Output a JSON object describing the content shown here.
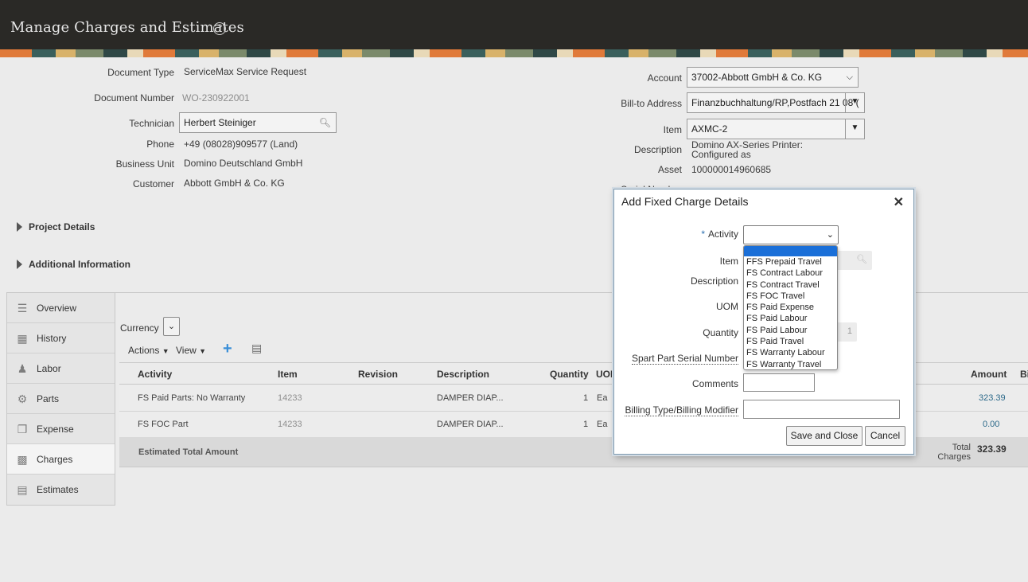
{
  "header": {
    "title": "Manage Charges and Estimates",
    "help_icon": "question-circle-icon"
  },
  "document": {
    "document_type_label": "Document Type",
    "document_type": "ServiceMax Service Request",
    "document_number_label": "Document Number",
    "document_number": "WO-230922001",
    "technician_label": "Technician",
    "technician": "Herbert Steiniger",
    "phone_label": "Phone",
    "phone": "+49 (08028)909577 (Land)",
    "business_unit_label": "Business Unit",
    "business_unit": "Domino Deutschland GmbH",
    "customer_label": "Customer",
    "customer": "Abbott GmbH & Co. KG"
  },
  "account_info": {
    "account_label": "Account",
    "account": "37002-Abbott GmbH & Co. KG",
    "bill_to_label": "Bill-to Address",
    "bill_to": "Finanzbuchhaltung/RP,Postfach 21 08 (",
    "item_label": "Item",
    "item": "AXMC-2",
    "description_label": "Description",
    "description_line1": "Domino AX-Series Printer:",
    "description_line2": "Configured as",
    "asset_label": "Asset",
    "asset": "100000014960685",
    "serial_label": "Serial Number"
  },
  "sections": {
    "project_details": "Project Details",
    "additional_information": "Additional Information"
  },
  "sidetabs": [
    {
      "label": "Overview",
      "icon": "overview-icon"
    },
    {
      "label": "History",
      "icon": "history-icon"
    },
    {
      "label": "Labor",
      "icon": "labor-icon"
    },
    {
      "label": "Parts",
      "icon": "parts-icon"
    },
    {
      "label": "Expense",
      "icon": "expense-icon"
    },
    {
      "label": "Charges",
      "icon": "charges-icon"
    },
    {
      "label": "Estimates",
      "icon": "estimates-icon"
    }
  ],
  "toolbar": {
    "currency_label": "Currency",
    "actions_label": "Actions",
    "view_label": "View"
  },
  "table": {
    "columns": {
      "activity": "Activity",
      "item": "Item",
      "revision": "Revision",
      "description": "Description",
      "quantity": "Quantity",
      "uom": "UOM",
      "amount": "Amount",
      "bi": "Bi"
    },
    "rows": [
      {
        "activity": "FS Paid Parts: No Warranty",
        "item": "14233",
        "description": "DAMPER DIAP...",
        "quantity": "1",
        "uom": "Ea",
        "amount": "323.39"
      },
      {
        "activity": "FS FOC Part",
        "item": "14233",
        "description": "DAMPER DIAP...",
        "quantity": "1",
        "uom": "Ea",
        "amount": "0.00"
      }
    ],
    "footer": {
      "estimated_total_label": "Estimated Total Amount",
      "total_charges_label_1": "Total",
      "total_charges_label_2": "Charges",
      "total_charges": "323.39"
    }
  },
  "modal": {
    "title": "Add Fixed Charge Details",
    "activity_label": "Activity",
    "item_label": "Item",
    "description_label": "Description",
    "uom_label": "UOM",
    "quantity_label": "Quantity",
    "quantity_value": "1",
    "spare_serial_label": "Spart Part Serial Number",
    "comments_label": "Comments",
    "billing_type_label": "Billing Type/Billing Modifier",
    "save_close_button": "Save and Close",
    "cancel_button": "Cancel"
  },
  "activity_options": [
    "",
    "FFS Prepaid Travel",
    "FS Contract Labour",
    "FS Contract Travel",
    "FS FOC Travel",
    "FS Paid Expense",
    "FS Paid Labour",
    "FS Paid Labour",
    "FS Paid Travel",
    "FS Warranty Labour",
    "FS Warranty Travel"
  ]
}
